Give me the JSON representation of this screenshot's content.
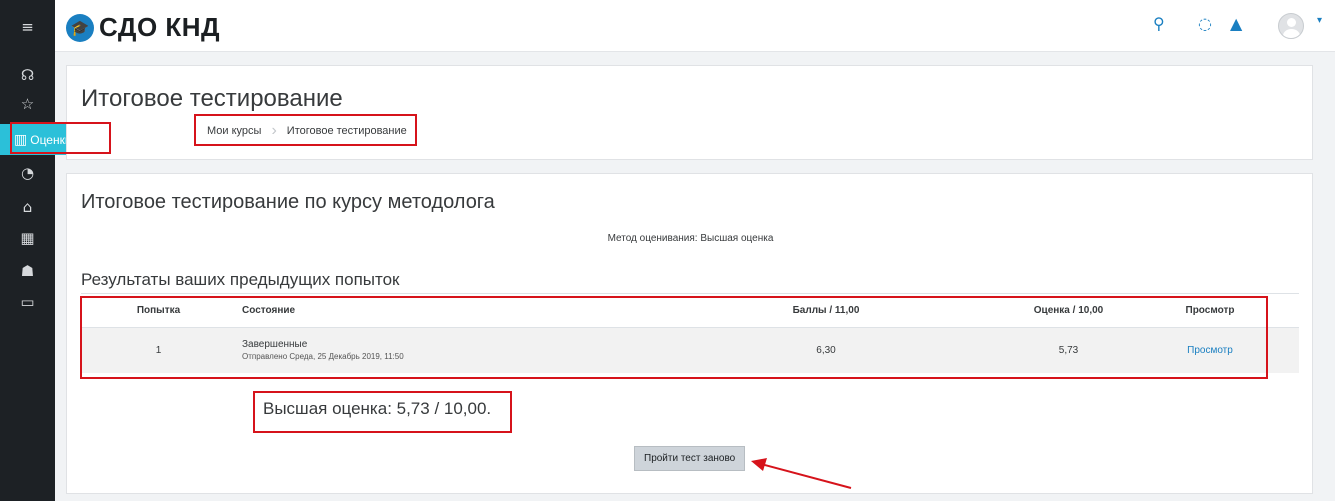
{
  "topbar": {
    "logo_text": "СДО КНД",
    "logo_icon": "graduation-cap-icon",
    "icons": [
      "search-icon",
      "chat-icon",
      "bell-icon",
      "avatar",
      "chevron-down-icon"
    ]
  },
  "sidebar": {
    "menu_icon": "hamburger-icon",
    "items": [
      {
        "icon": "badges-icon"
      },
      {
        "icon": "star-icon"
      },
      {
        "icon": "grades-book-icon",
        "label": "Оценки"
      },
      {
        "icon": "dashboard-icon"
      },
      {
        "icon": "home-icon"
      },
      {
        "icon": "calendar-icon"
      },
      {
        "icon": "graduation-cap-icon"
      },
      {
        "icon": "folder-icon"
      }
    ],
    "active_color": "#2bc0d9"
  },
  "header": {
    "title": "Итоговое тестирование",
    "breadcrumb": [
      "Мои курсы",
      "Итоговое тестирование"
    ]
  },
  "quiz": {
    "title": "Итоговое тестирование по курсу методолога",
    "grading_method": "Метод оценивания: Высшая оценка",
    "attempts_heading": "Результаты ваших предыдущих попыток",
    "table": {
      "headers": [
        "Попытка",
        "Состояние",
        "Баллы / 11,00",
        "Оценка / 10,00",
        "Просмотр"
      ],
      "rows": [
        {
          "attempt": "1",
          "state": "Завершенные",
          "submitted": "Отправлено Среда, 25 Декабрь 2019, 11:50",
          "points": "6,30",
          "grade": "5,73",
          "review": "Просмотр"
        }
      ]
    },
    "highest_grade": "Высшая оценка: 5,73 / 10,00.",
    "retake_button": "Пройти тест заново"
  },
  "colors": {
    "accent": "#1a7fc1",
    "sidebar_bg": "#1d2125",
    "annotation": "#d6131b"
  }
}
